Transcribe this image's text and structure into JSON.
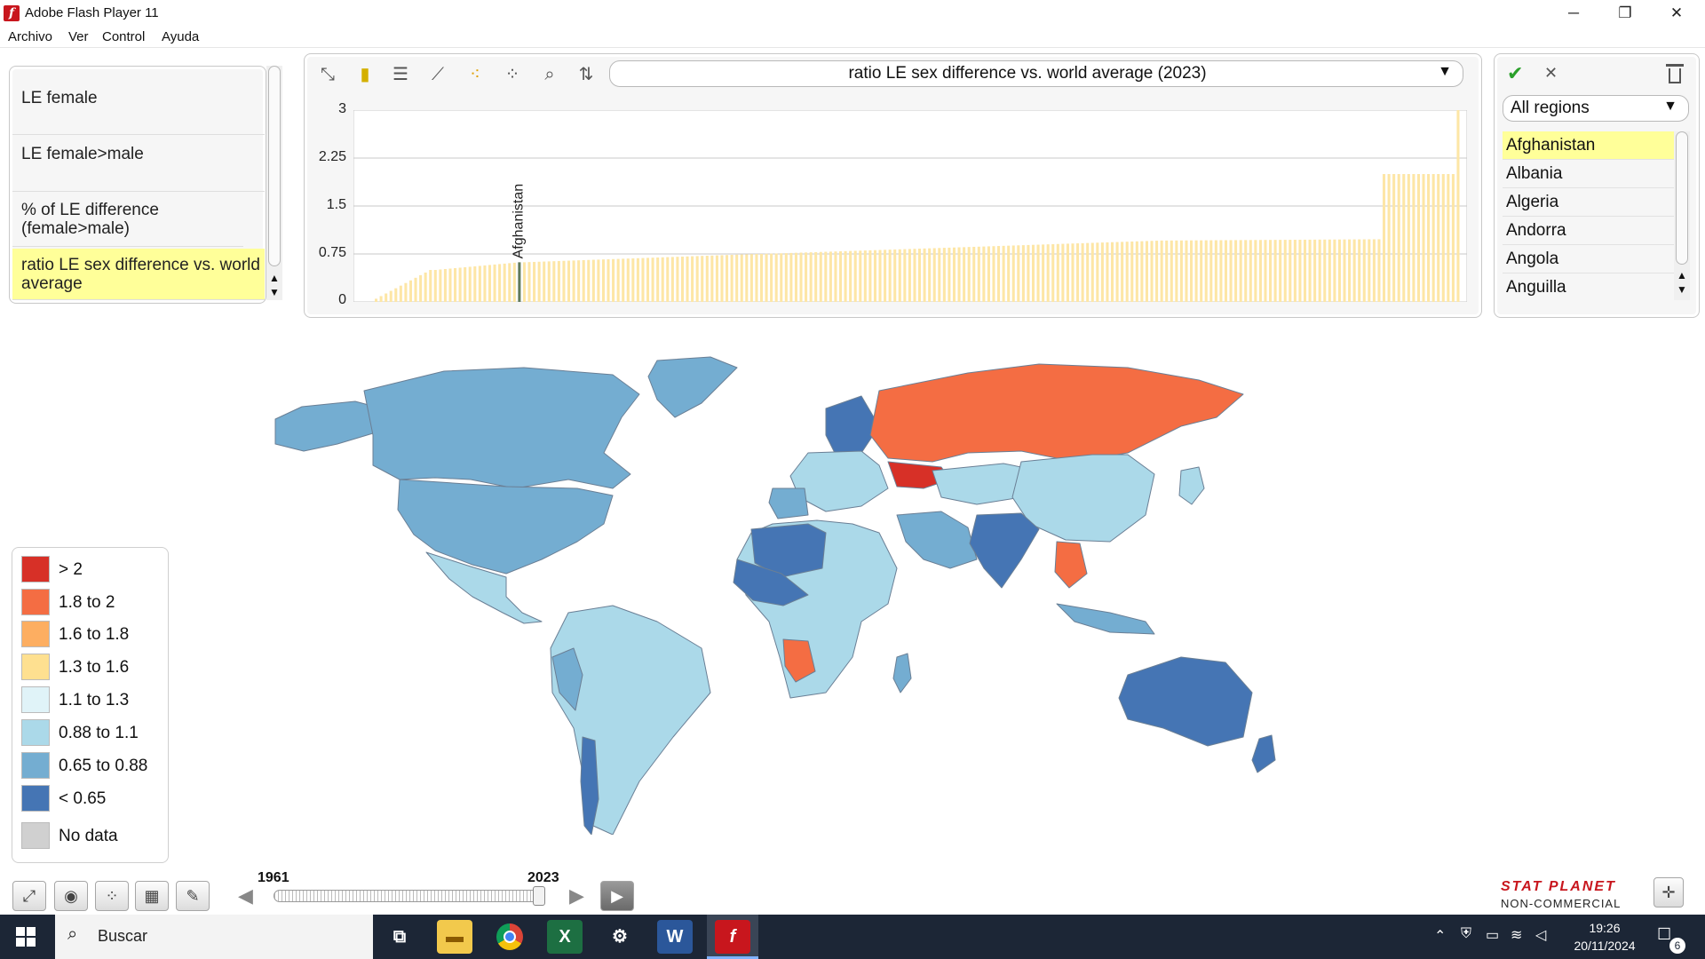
{
  "window": {
    "title": "Adobe Flash Player 11",
    "minimize": "─",
    "restore": "❐",
    "close": "✕"
  },
  "menu": [
    "Archivo",
    "Ver",
    "Control",
    "Ayuda"
  ],
  "indicators": {
    "items": [
      "LE female",
      "LE female>male",
      "% of LE difference (female>male)",
      "ratio LE sex difference vs. world average"
    ],
    "selected": "ratio LE sex difference vs. world average"
  },
  "toolbar": {
    "icons": [
      "expand-icon",
      "bar-chart-icon",
      "horizontal-bar-icon",
      "line-chart-icon",
      "scatter-icon",
      "bubble-icon",
      "zoom-icon",
      "sort-icon"
    ],
    "indicator_dropdown": "ratio LE sex difference vs. world average (2023)"
  },
  "chart_data": {
    "type": "bar",
    "yticks": [
      "3",
      "2.25",
      "1.5",
      "0.75",
      "0"
    ],
    "ylim": [
      0,
      3
    ],
    "highlight_label": "Afghanistan",
    "highlight_value": 0.62,
    "n_bars": 220,
    "segments": [
      {
        "start": 0.05,
        "end": 0.5,
        "count": 12
      },
      {
        "start": 0.5,
        "end": 0.62,
        "count": 18
      },
      {
        "start": 0.62,
        "end": 0.75,
        "count": 48
      },
      {
        "start": 0.75,
        "end": 0.96,
        "count": 82
      },
      {
        "start": 0.96,
        "end": 0.98,
        "count": 44
      },
      {
        "start": 2.0,
        "end": 2.0,
        "count": 15
      },
      {
        "start": 3.0,
        "end": 3.0,
        "count": 1
      }
    ],
    "bar_color": "#fde6a6"
  },
  "regions": {
    "dropdown": "All regions",
    "confirm_icon": "✔",
    "cancel_icon": "✕",
    "trash_icon": "trash-icon",
    "items": [
      "Afghanistan",
      "Albania",
      "Algeria",
      "Andorra",
      "Angola",
      "Anguilla"
    ],
    "selected": "Afghanistan"
  },
  "legend": [
    {
      "label": "> 2",
      "color": "#d73027"
    },
    {
      "label": "1.8 to 2",
      "color": "#f46d43"
    },
    {
      "label": "1.6 to 1.8",
      "color": "#fdae61"
    },
    {
      "label": "1.3 to 1.6",
      "color": "#fee090"
    },
    {
      "label": "1.1 to 1.3",
      "color": "#e0f3f8"
    },
    {
      "label": "0.88 to 1.1",
      "color": "#abd9e9"
    },
    {
      "label": "0.65 to 0.88",
      "color": "#74add1"
    },
    {
      "label": "< 0.65",
      "color": "#4575b4"
    },
    {
      "label": "No data",
      "color": "#d0d0d0"
    }
  ],
  "timeline": {
    "start_year": "1961",
    "end_year": "2023",
    "position": 1.0
  },
  "branding": {
    "line1": "STAT PLANET",
    "line2": "NON-COMMERCIAL"
  },
  "taskbar": {
    "search_placeholder": "Buscar",
    "apps": [
      "task-view-icon",
      "file-explorer-icon",
      "chrome-icon",
      "excel-icon",
      "settings-icon",
      "word-icon",
      "flash-icon"
    ],
    "time": "19:26",
    "date": "20/11/2024",
    "notifications": "6"
  }
}
